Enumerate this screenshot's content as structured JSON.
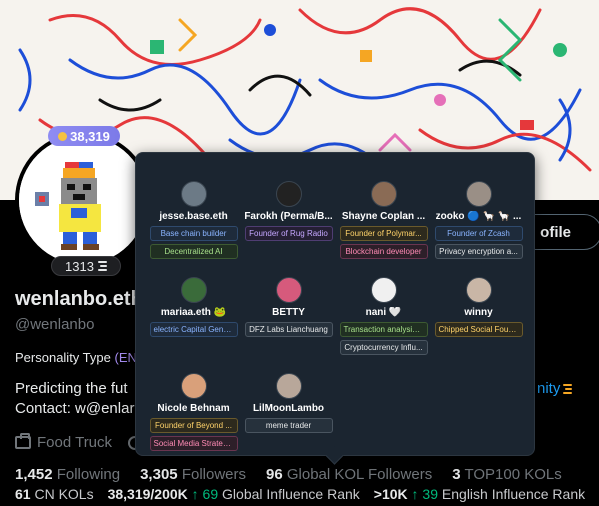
{
  "profile": {
    "score": "38,319",
    "kol_count": "1313",
    "display_name": "wenlanbo.eth",
    "handle": "@wenlanbo",
    "personality_label": "Personality Type",
    "personality_value": "(ENT",
    "bio_line1": "Predicting the fut",
    "bio_line2": "Contact: w@enlar",
    "bio_link": "nity",
    "location": "Food Truck",
    "edit_button": "ofile"
  },
  "stats": {
    "following_count": "1,452",
    "following_label": "Following",
    "followers_count": "3,305",
    "followers_label": "Followers",
    "global_kol_count": "96",
    "global_kol_label": "Global KOL Followers",
    "top100_count": "3",
    "top100_label": "TOP100 KOLs",
    "cn_kol_count": "61",
    "cn_kol_label": "CN KOLs",
    "influence_score": "38,319/200K",
    "global_rank_delta": "↑ 69",
    "global_rank_label": "Global Influence Rank",
    "english_rank": ">10K",
    "english_rank_delta": "↑ 39",
    "english_rank_label": "English Influence Rank"
  },
  "kol_popover": {
    "kols": [
      {
        "name": "jesse.base.eth",
        "avatar_color": "#6c7a86",
        "tags": [
          {
            "text": "Base chain builder",
            "color": "blue"
          },
          {
            "text": "Decentralized AI",
            "color": "green"
          }
        ]
      },
      {
        "name": "Farokh (Perma/B...",
        "avatar_color": "#222222",
        "tags": [
          {
            "text": "Founder of Rug Radio",
            "color": "purple"
          }
        ]
      },
      {
        "name": "Shayne Coplan ...",
        "avatar_color": "#8a6b55",
        "tags": [
          {
            "text": "Founder of Polymar...",
            "color": "yellow"
          },
          {
            "text": "Blockchain developer",
            "color": "pink"
          }
        ]
      },
      {
        "name": "zooko 🔵 🦙 🦙 ...",
        "avatar_color": "#9a8f86",
        "tags": [
          {
            "text": "Founder of Zcash",
            "color": "blue"
          },
          {
            "text": "Privacy encryption a...",
            "color": "white"
          }
        ]
      },
      {
        "name": "mariaa.eth 🐸",
        "avatar_color": "#3a6b3a",
        "tags": [
          {
            "text": "electric Capital Gene...",
            "color": "blue"
          }
        ]
      },
      {
        "name": "BETTY",
        "avatar_color": "#d65a7c",
        "tags": [
          {
            "text": "DFZ Labs Lianchuang",
            "color": "white"
          }
        ]
      },
      {
        "name": "nani 🤍",
        "avatar_color": "#f0f0f0",
        "tags": [
          {
            "text": "Transaction analysis ...",
            "color": "green"
          },
          {
            "text": "Cryptocurrency Influ...",
            "color": "white"
          }
        ]
      },
      {
        "name": "winny",
        "avatar_color": "#c9b6a6",
        "tags": [
          {
            "text": "Chipped Social Foun...",
            "color": "yellow"
          }
        ]
      },
      {
        "name": "Nicole Behnam",
        "avatar_color": "#d9a07a",
        "tags": [
          {
            "text": "Founder of Beyond ...",
            "color": "yellow"
          },
          {
            "text": "Social Media Strateg...",
            "color": "pink"
          }
        ]
      },
      {
        "name": "LilMoonLambo",
        "avatar_color": "#b8a79a",
        "tags": [
          {
            "text": "meme trader",
            "color": "white"
          }
        ]
      }
    ]
  }
}
